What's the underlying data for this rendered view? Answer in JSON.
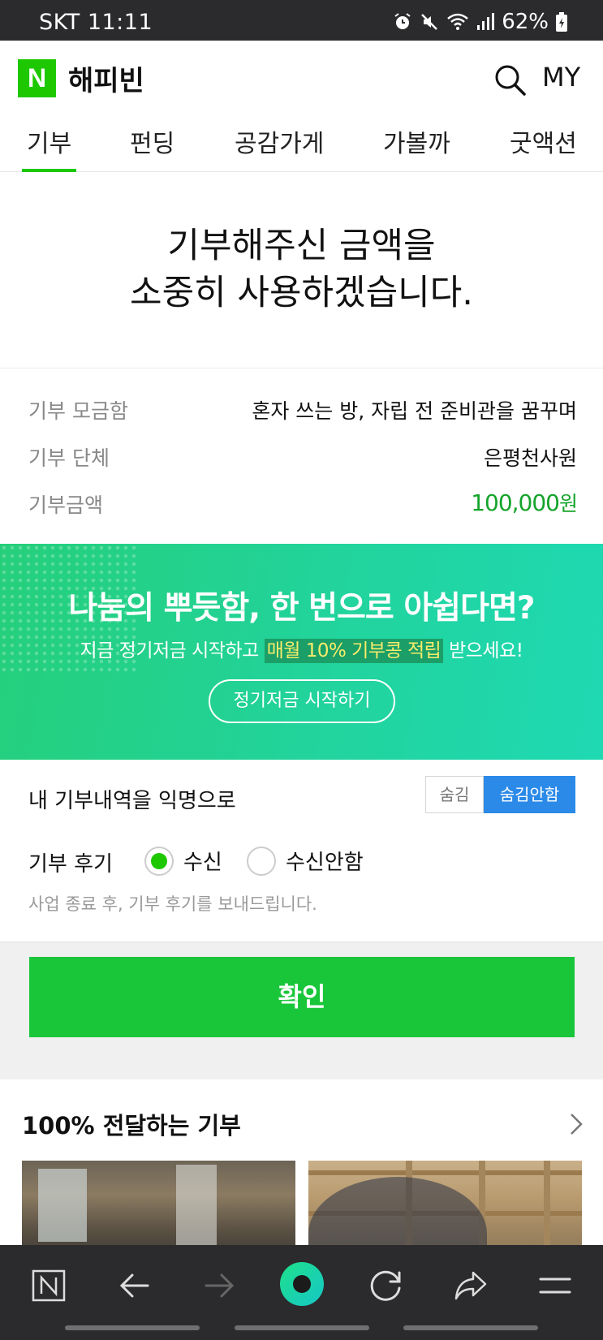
{
  "status_bar": {
    "carrier_time": "SKT 11:11",
    "battery": "62%"
  },
  "header": {
    "brand": "해피빈",
    "logo_letter": "N",
    "my_label": "MY"
  },
  "tabs": [
    {
      "label": "기부",
      "active": true
    },
    {
      "label": "펀딩",
      "active": false
    },
    {
      "label": "공감가게",
      "active": false
    },
    {
      "label": "가볼까",
      "active": false
    },
    {
      "label": "굿액션",
      "active": false
    }
  ],
  "hero": {
    "line1": "기부해주신 금액을",
    "line2": "소중히 사용하겠습니다."
  },
  "info": {
    "box_label": "기부 모금함",
    "box_value": "혼자 쓰는 방, 자립 전 준비관을 꿈꾸며",
    "org_label": "기부 단체",
    "org_value": "은평천사원",
    "amount_label": "기부금액",
    "amount_value": "100,000",
    "amount_unit": "원"
  },
  "banner": {
    "headline": "나눔의 뿌듯함, 한 번으로 아쉽다면?",
    "sub_before": "지금 정기저금 시작하고 ",
    "sub_highlight": "매월 10% 기부콩 적립",
    "sub_after": " 받으세요!",
    "cta": "정기저금 시작하기"
  },
  "anonymity": {
    "label": "내 기부내역을 익명으로",
    "hide": "숨김",
    "show": "숨김안함",
    "selected": "숨김안함"
  },
  "review": {
    "label": "기부 후기",
    "option_receive": "수신",
    "option_decline": "수신안함",
    "selected": "수신",
    "note": "사업 종료 후, 기부 후기를 보내드립니다."
  },
  "confirm_label": "확인",
  "recommendations": {
    "title": "100% 전달하는 기부"
  },
  "colors": {
    "brand_green": "#1ec800",
    "confirm_green": "#19c63a",
    "toggle_blue": "#2b8ae8",
    "amount_green": "#15a42b"
  }
}
